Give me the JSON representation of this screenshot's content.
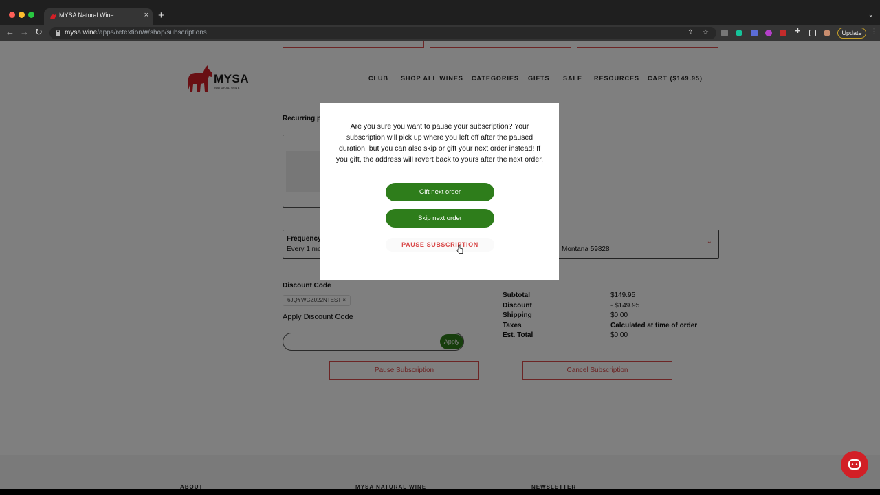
{
  "browser": {
    "tab_title": "MYSA Natural Wine",
    "url_domain": "mysa.wine",
    "url_path": "/apps/retextion/#/shop/subscriptions",
    "update_label": "Update"
  },
  "header": {
    "logo_text": "MYSA",
    "logo_sub": "NATURAL WINE",
    "nav": [
      {
        "label": "CLUB"
      },
      {
        "label": "SHOP ALL WINES"
      },
      {
        "label": "CATEGORIES"
      },
      {
        "label": "GIFTS"
      },
      {
        "label": "SALE"
      },
      {
        "label": "RESOURCES"
      },
      {
        "label": "CART ($149.95)"
      }
    ]
  },
  "subscription": {
    "recurring_label": "Recurring pr",
    "frequency_label": "Frequency",
    "frequency_value": "Every 1 mo",
    "address_value": "Montana 59828",
    "discount_code_label": "Discount Code",
    "discount_chip": "6JQYWGZ022NTEST",
    "apply_label": "Apply Discount Code",
    "apply_button": "Apply",
    "pause_button": "Pause Subscription",
    "cancel_button": "Cancel Subscription"
  },
  "summary": [
    {
      "key": "Subtotal",
      "value": "$149.95"
    },
    {
      "key": "Discount",
      "value": "- $149.95"
    },
    {
      "key": "Shipping",
      "value": "$0.00"
    },
    {
      "key": "Taxes",
      "value": "Calculated at time of order"
    },
    {
      "key": "Est. Total",
      "value": "$0.00"
    }
  ],
  "modal": {
    "message": "Are you sure you want to pause your subscription? Your subscription will pick up where you left off after the paused duration, but you can also skip or gift your next order instead! If you gift, the address will revert back to yours after the next order.",
    "gift_button": "Gift next order",
    "skip_button": "Skip next order",
    "pause_button": "PAUSE SUBSCRIPTION"
  },
  "footer": {
    "headings": [
      "ABOUT",
      "MYSA NATURAL WINE",
      "NEWSLETTER"
    ]
  },
  "colors": {
    "brand_red": "#d94a4a",
    "button_green": "#2e7d1b"
  }
}
